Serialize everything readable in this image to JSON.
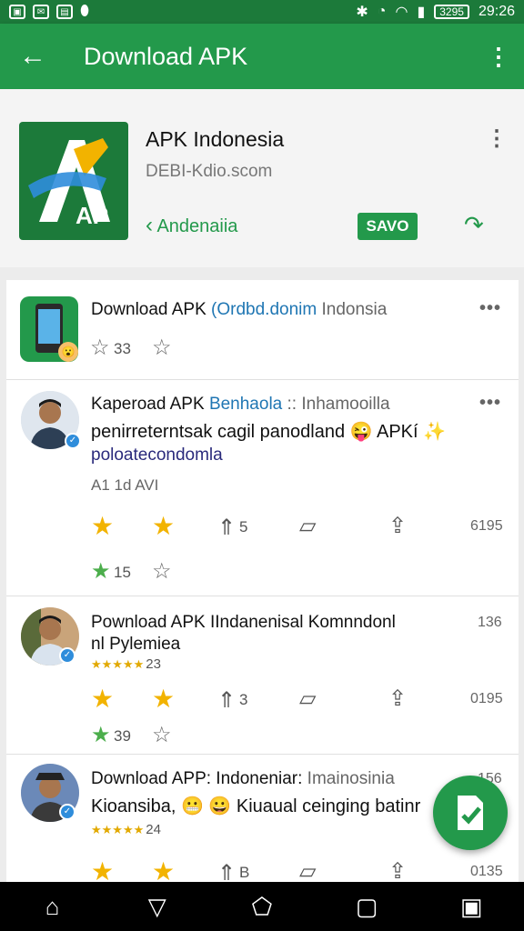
{
  "status_bar": {
    "time": "29:26",
    "battery": "3295",
    "icons": [
      "photo-icon",
      "mail-icon",
      "gallery-icon",
      "shield-icon",
      "bluetooth-icon",
      "alarm-icon",
      "wifi-icon",
      "signal-icon"
    ]
  },
  "appbar": {
    "title": "Download APK",
    "back_icon": "arrow-left-icon",
    "menu_icon": "more-vertical-icon"
  },
  "app_info": {
    "name": "APK Indonesia",
    "domain": "DEBI-Kdio.scom",
    "back_label": "Andenaiia",
    "save_label": "SAVO",
    "logo_text": "AP"
  },
  "posts": [
    {
      "title_main": "Download APK",
      "title_link": "(Ordbd.donim",
      "title_rest": "Indonsia",
      "rating_count": "33"
    },
    {
      "title_main": "Kaperoad APK",
      "title_link": "Benhaola",
      "title_rest": ":: Inhamooilla",
      "body": "penirreterntsak cagil panodland 😜 APKí ✨",
      "link": "poloatecondomla",
      "meta": "A1 1d AVI",
      "reposts": "5",
      "count": "6195",
      "rating_count": "15"
    },
    {
      "title_main": "Pownload APK IIndanenisal Komnndonl",
      "title_line2": "nl Pylemiea",
      "time": "136",
      "stars_count": "23",
      "reposts": "3",
      "count": "0195",
      "rating_count": "39"
    },
    {
      "title_main": "Download APP: Indoneniar:",
      "title_rest": "Imainosinia",
      "time": "156",
      "body": "Kioansiba, 😬 😀 Kiuaual ceinging batinr",
      "stars_count": "24",
      "reposts": "B",
      "count": "0135"
    }
  ],
  "navbar": {
    "icons": [
      "home-icon",
      "back-icon",
      "overview-icon",
      "recents-icon",
      "screenshot-icon"
    ]
  },
  "colors": {
    "primary": "#23994b",
    "primary_dark": "#1c7a3a",
    "star_yellow": "#f2b300",
    "star_green": "#4cae4c"
  }
}
